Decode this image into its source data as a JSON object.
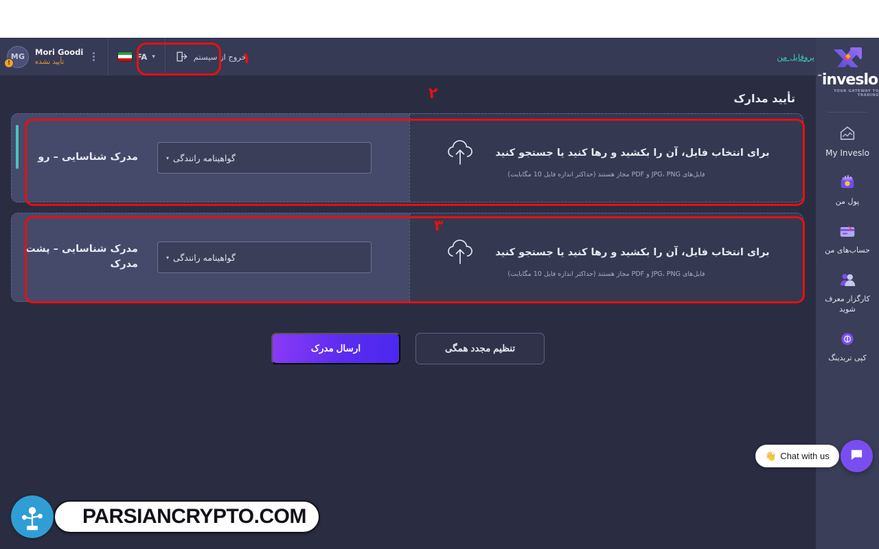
{
  "topbar": {
    "profile_link": "پروفایل من",
    "logout_label": "خروج از سیستم",
    "logout_icon": "logout-icon",
    "language": {
      "code": "FA",
      "flag": "iran-flag-icon",
      "caret": "chevron-down-icon"
    },
    "user": {
      "name": "Mori Goodi",
      "status": "تأیید نشده",
      "avatar_initials": "MG",
      "badge_icon": "warning-badge-icon",
      "menu_icon": "kebab-menu-icon"
    }
  },
  "sidebar": {
    "brand": {
      "name": "inveslo",
      "trademark": "™",
      "tagline": "YOUR GATEWAY TO TRADING",
      "logo_icon": "inveslo-arrow-logo"
    },
    "items": [
      {
        "label": "My Inveslo",
        "icon": "home-icon",
        "lang": "en"
      },
      {
        "label": "پول من",
        "icon": "wallet-icon",
        "lang": "fa"
      },
      {
        "label": "حساب‌های من",
        "icon": "card-icon",
        "lang": "fa"
      },
      {
        "label": "کارگزار معرف شوید",
        "icon": "people-icon",
        "lang": "fa"
      },
      {
        "label": "کپی تریدینگ",
        "icon": "copy-trading-icon",
        "lang": "fa"
      }
    ]
  },
  "main": {
    "page_title": "تأیید مدارک",
    "cards": [
      {
        "doc_label": "مدرک شناسایی – رو",
        "select_value": "گواهینامه رانندگی",
        "select_caret": "chevron-down-icon",
        "drop_main": "برای انتخاب فایل، آن را بکشید و رها کنید یا جستجو کنید",
        "drop_hint": "فایل‌های JPG، PNG و PDF مجاز هستند (حداکثر اندازه فایل 10 مگابایت)",
        "upload_icon": "cloud-upload-icon",
        "has_scrollbar": true
      },
      {
        "doc_label": "مدرک شناسایی – پشت مدرک",
        "select_value": "گواهینامه رانندگی",
        "select_caret": "chevron-down-icon",
        "drop_main": "برای انتخاب فایل، آن را بکشید و رها کنید یا جستجو کنید",
        "drop_hint": "فایل‌های JPG، PNG و PDF مجاز هستند (حداکثر اندازه فایل 10 مگابایت)",
        "upload_icon": "cloud-upload-icon",
        "has_scrollbar": false
      }
    ],
    "buttons": {
      "submit": "ارسال مدرک",
      "reset": "تنظیم مجدد همگی"
    }
  },
  "annotations": {
    "one": "۱",
    "two": "۲",
    "three": "۳",
    "color": "#e81010"
  },
  "chat": {
    "label": "Chat with us",
    "emoji": "👋",
    "button_icon": "chat-bubble-icon"
  },
  "watermark": {
    "text": "PARSIANCRYPTO.COM",
    "logo_icon": "parsiancrypto-logo-icon"
  },
  "colors": {
    "page_bg": "#2a2c42",
    "sidebar_bg": "#3a3e58",
    "topbar_bg": "#363a54",
    "card_bg": "#454a6b",
    "accent_purple": "#5b2cf0",
    "accent_teal": "#3fd0c0",
    "status_orange": "#f09a2b"
  }
}
